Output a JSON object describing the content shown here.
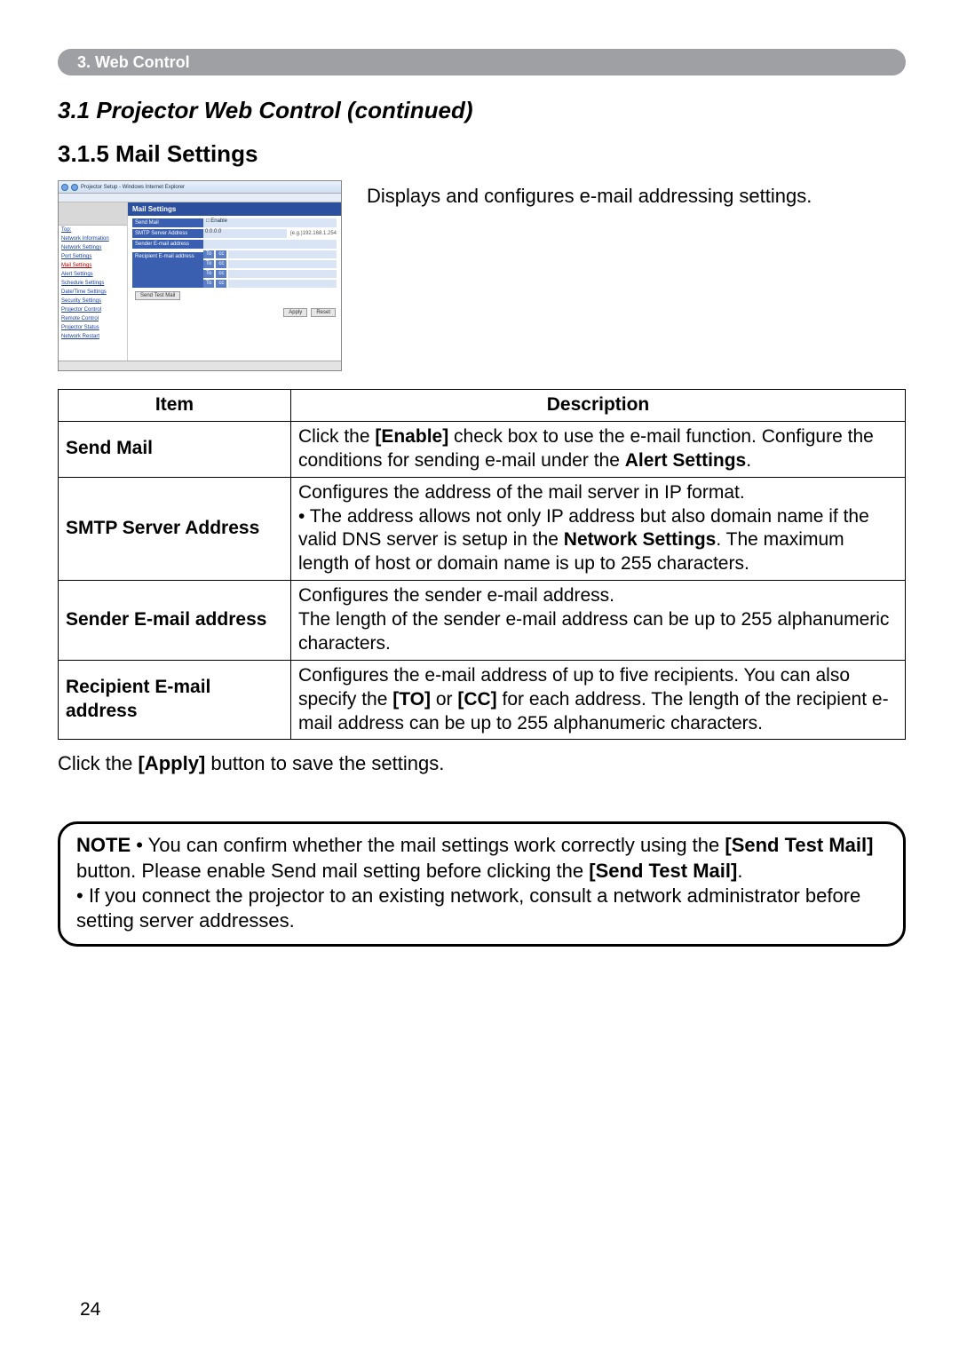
{
  "chapter_bar": "3. Web Control",
  "section_title": "3.1 Projector Web Control (continued)",
  "subsection_title": "3.1.5 Mail Settings",
  "intro_text": "Displays and configures e-mail addressing settings.",
  "screenshot": {
    "window_title": "Projector Setup - Windows Internet Explorer",
    "panel_title": "Mail Settings",
    "nav": {
      "items": [
        "Top:",
        "Network Information",
        "Network Settings",
        "Port Settings",
        "Mail Settings",
        "Alert Settings",
        "Schedule Settings",
        "Date/Time Settings",
        "Security Settings",
        "Projector Control",
        "Remote Control",
        "Projector Status",
        "Network Restart"
      ],
      "active_index": 4
    },
    "rows": {
      "send_mail": "Send Mail",
      "enable": "Enable",
      "smtp": "SMTP Server Address",
      "smtp_val": "0.0.0.0",
      "smtp_hint": "(e.g.)192.168.1.254",
      "sender": "Sender E-mail address",
      "recipient": "Recipient E-mail address",
      "to": "To",
      "cc": "cc"
    },
    "buttons": {
      "test": "Send Test Mail",
      "apply": "Apply",
      "reset": "Reset"
    }
  },
  "table": {
    "head_item": "Item",
    "head_desc": "Description",
    "rows": [
      {
        "item": "Send Mail",
        "desc_pre": "Click the ",
        "desc_b1": "[Enable]",
        "desc_mid": " check box to use the e-mail function. Configure the conditions for sending e-mail under the ",
        "desc_b2": "Alert Settings",
        "desc_post": "."
      },
      {
        "item": "SMTP Server Address",
        "desc_pre": "Configures the address of the mail server in IP format.\n• The address allows not only IP address but also domain name if the valid DNS server is setup in the ",
        "desc_b1": "Network Settings",
        "desc_post": ". The maximum length of host or domain name is up to 255 characters."
      },
      {
        "item": "Sender E-mail address",
        "desc_plain": "Configures the sender e-mail address.\nThe length of the sender e-mail address can be up to 255 alphanumeric characters."
      },
      {
        "item": "Recipient E-mail address",
        "desc_pre": "Configures the e-mail address of up to five recipients. You can also specify the ",
        "desc_b1": "[TO]",
        "desc_mid": " or ",
        "desc_b2": "[CC]",
        "desc_post": " for each address. The length of the recipient e-mail address can be up to 255 alphanumeric characters."
      }
    ]
  },
  "after_table_pre": "Click the ",
  "after_table_b": "[Apply]",
  "after_table_post": " button to save the settings.",
  "note": {
    "label": "NOTE",
    "l1_pre": "  • You can confirm whether the mail settings work correctly using the ",
    "l1_b": "[Send Test Mail]",
    "l1_mid": " button. Please enable Send mail setting before clicking the ",
    "l1_b2": "[Send Test Mail]",
    "l1_post": ".",
    "l2": "• If you connect the projector to an existing network, consult a network administrator before setting server addresses."
  },
  "page_number": "24"
}
